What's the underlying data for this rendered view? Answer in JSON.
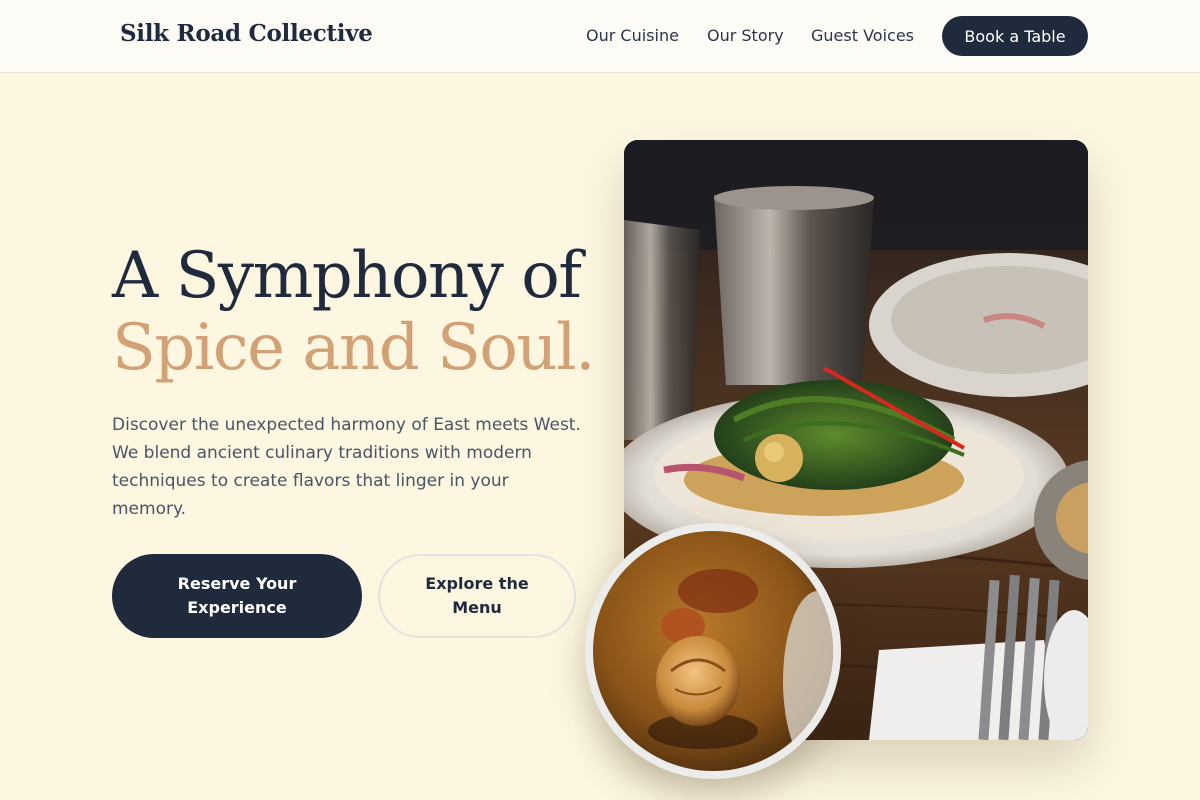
{
  "nav": {
    "brand": "Silk Road Collective",
    "links": [
      {
        "label": "Our Cuisine"
      },
      {
        "label": "Our Story"
      },
      {
        "label": "Guest Voices"
      }
    ],
    "cta": "Book a Table"
  },
  "hero": {
    "title_line1": "A Symphony of",
    "title_line2": "Spice and Soul.",
    "description": "Discover the unexpected harmony of East meets West. We blend ancient culinary traditions with modern techniques to create flavors that linger in your memory.",
    "primary_button": "Reserve Your Experience",
    "secondary_button": "Explore the Menu"
  },
  "images": {
    "main_image": "restaurant-dish-photo",
    "inset_image": "food-closeup-photo"
  },
  "colors": {
    "background": "#fdf7e1",
    "navy": "#1f2a3d",
    "accent": "#d2a276"
  }
}
